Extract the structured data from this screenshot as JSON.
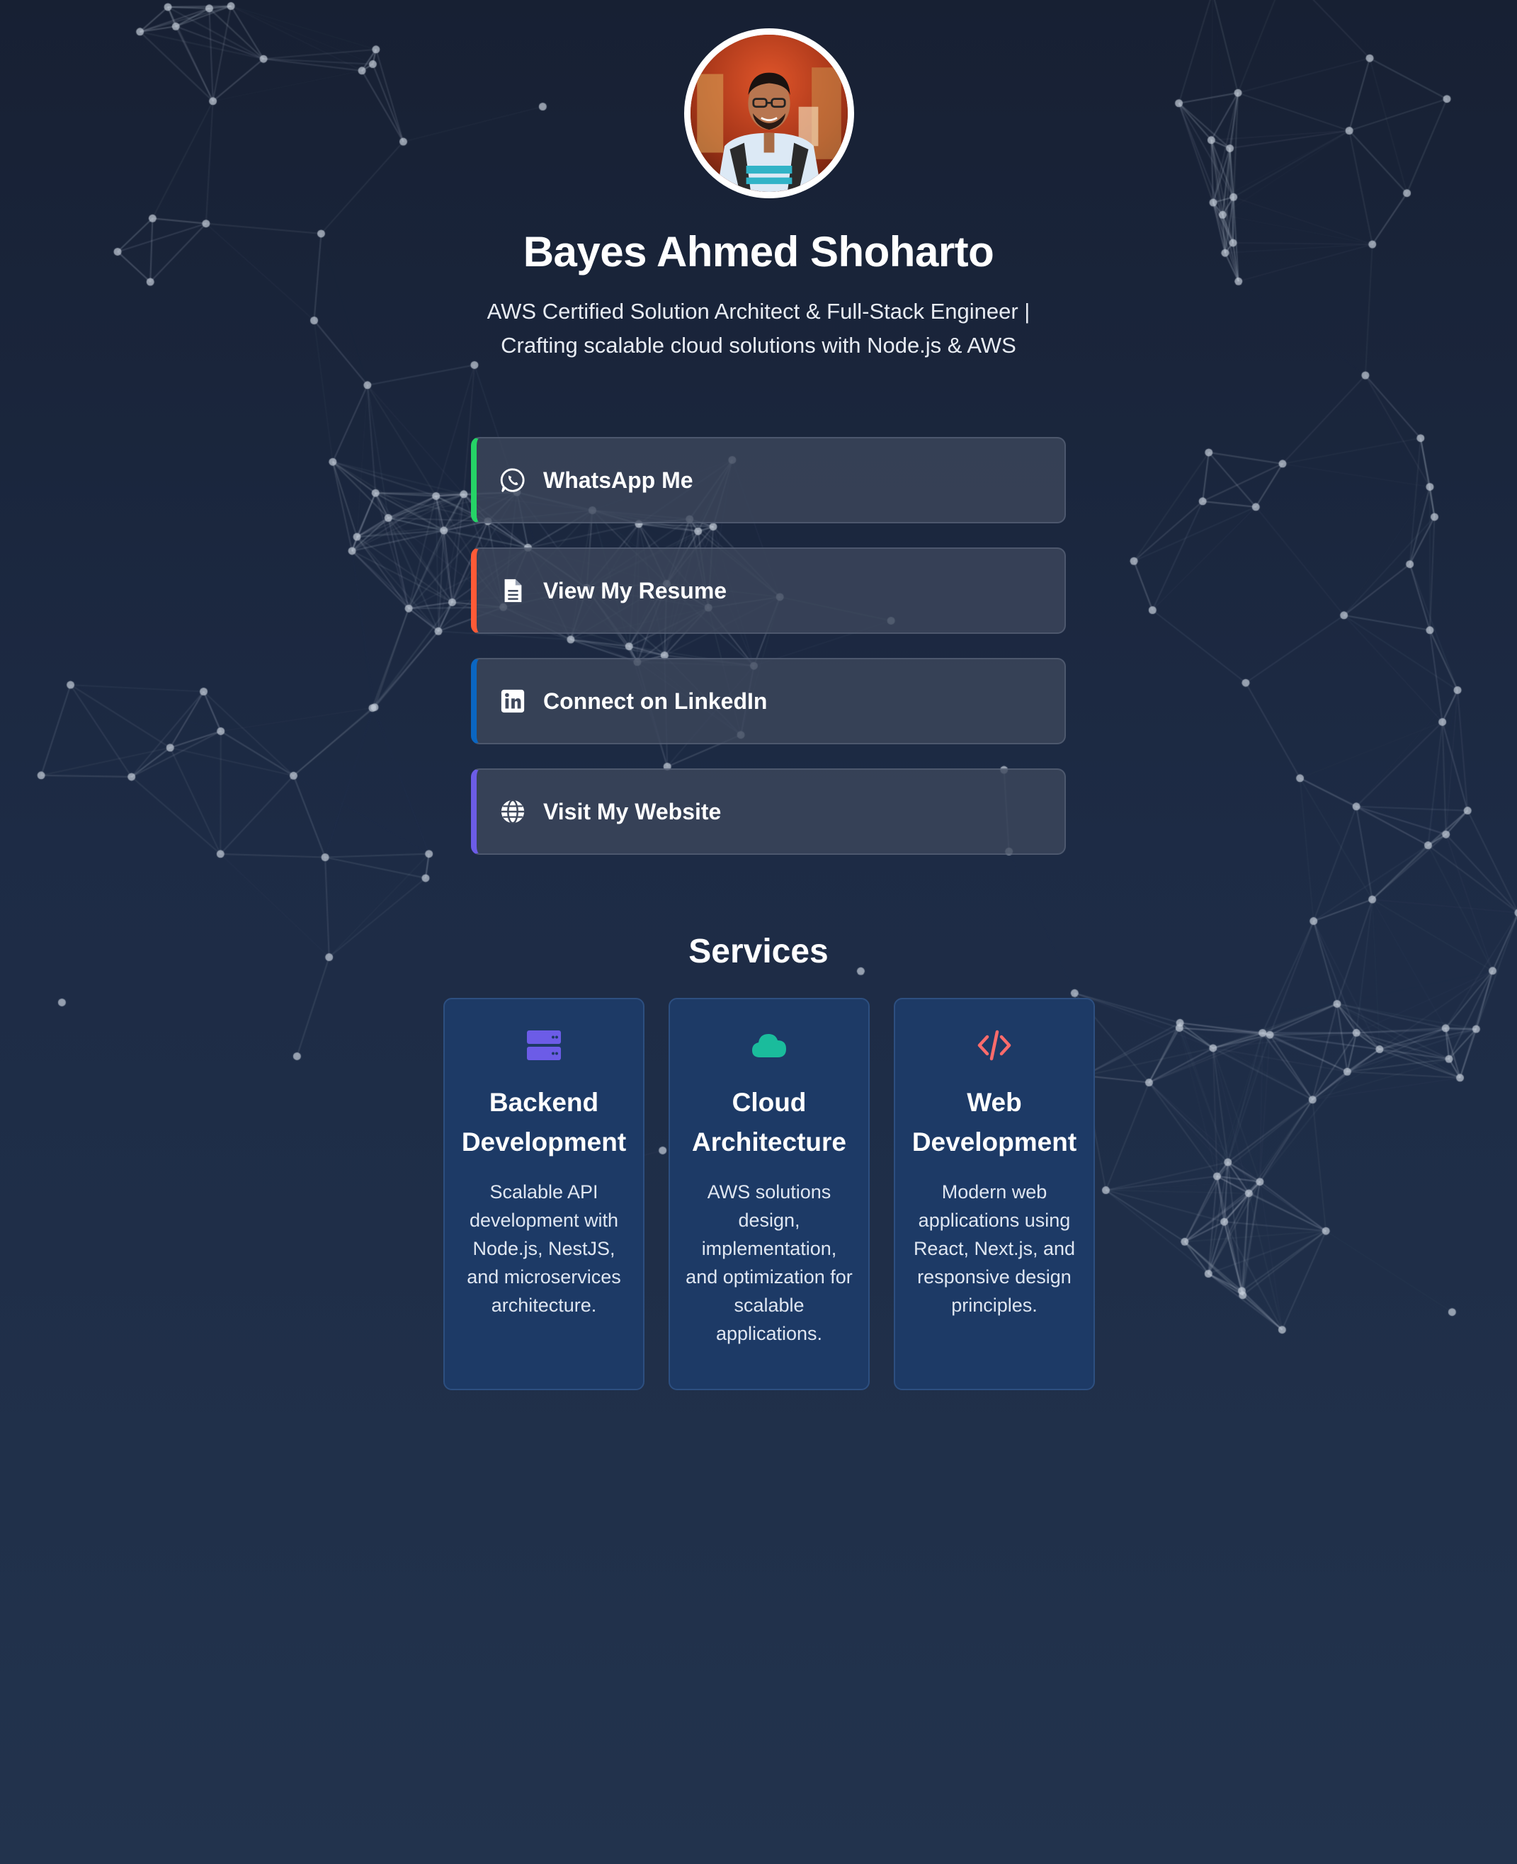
{
  "profile": {
    "name": "Bayes Ahmed Shoharto",
    "tagline_line1": "AWS Certified Solution Architect & Full-Stack Engineer |",
    "tagline_line2": "Crafting scalable cloud solutions with Node.js & AWS",
    "avatar_icon": "profile-photo"
  },
  "links": [
    {
      "label": "WhatsApp Me",
      "icon": "whatsapp-icon",
      "accent": "#25d366"
    },
    {
      "label": "View My Resume",
      "icon": "document-icon",
      "accent": "#ff5a36"
    },
    {
      "label": "Connect on LinkedIn",
      "icon": "linkedin-icon",
      "accent": "#0a66c2"
    },
    {
      "label": "Visit My Website",
      "icon": "globe-icon",
      "accent": "#6c5ce7"
    }
  ],
  "services": {
    "title": "Services",
    "cards": [
      {
        "title_line1": "Backend",
        "title_line2": "Development",
        "description": "Scalable API development with Node.js, NestJS, and microservices architecture.",
        "icon": "server-icon",
        "icon_color": "#6c5ce7"
      },
      {
        "title_line1": "Cloud",
        "title_line2": "Architecture",
        "description": "AWS solutions design, implementation, and optimization for scalable applications.",
        "icon": "cloud-icon",
        "icon_color": "#1abc9c"
      },
      {
        "title_line1": "Web",
        "title_line2": "Development",
        "description": "Modern web applications using React, Next.js, and responsive design principles.",
        "icon": "code-icon",
        "icon_color": "#ff6b6b"
      }
    ]
  }
}
